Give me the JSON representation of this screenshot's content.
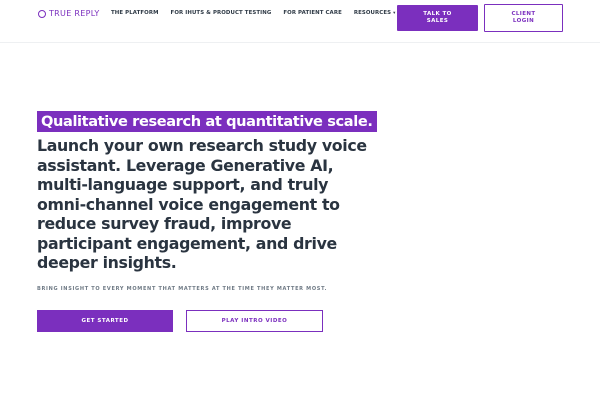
{
  "header": {
    "logo_text": "TRUE REPLY",
    "nav": [
      {
        "label": "THE PLATFORM"
      },
      {
        "label": "FOR IHUTS & PRODUCT TESTING"
      },
      {
        "label": "FOR PATIENT CARE"
      },
      {
        "label": "RESOURCES",
        "icon": "chevron-down-icon"
      }
    ],
    "talk_to_sales_label": "TALK TO SALES",
    "client_login_label": "CLIENT LOGIN"
  },
  "hero": {
    "tagline": "Qualitative research at quantitative scale.",
    "headline": "Launch your own research study voice assistant. Leverage Generative AI, multi-language support, and truly omni-channel voice engagement to reduce survey fraud, improve participant engagement, and drive deeper insights.",
    "subtext": "BRING INSIGHT TO EVERY MOMENT THAT MATTERS AT THE TIME THEY MATTER MOST.",
    "get_started_label": "GET STARTED",
    "play_video_label": "PLAY INTRO VIDEO"
  },
  "colors": {
    "accent": "#7b2fbe",
    "text_dark": "#2a3440",
    "text_muted": "#6f7a85"
  }
}
